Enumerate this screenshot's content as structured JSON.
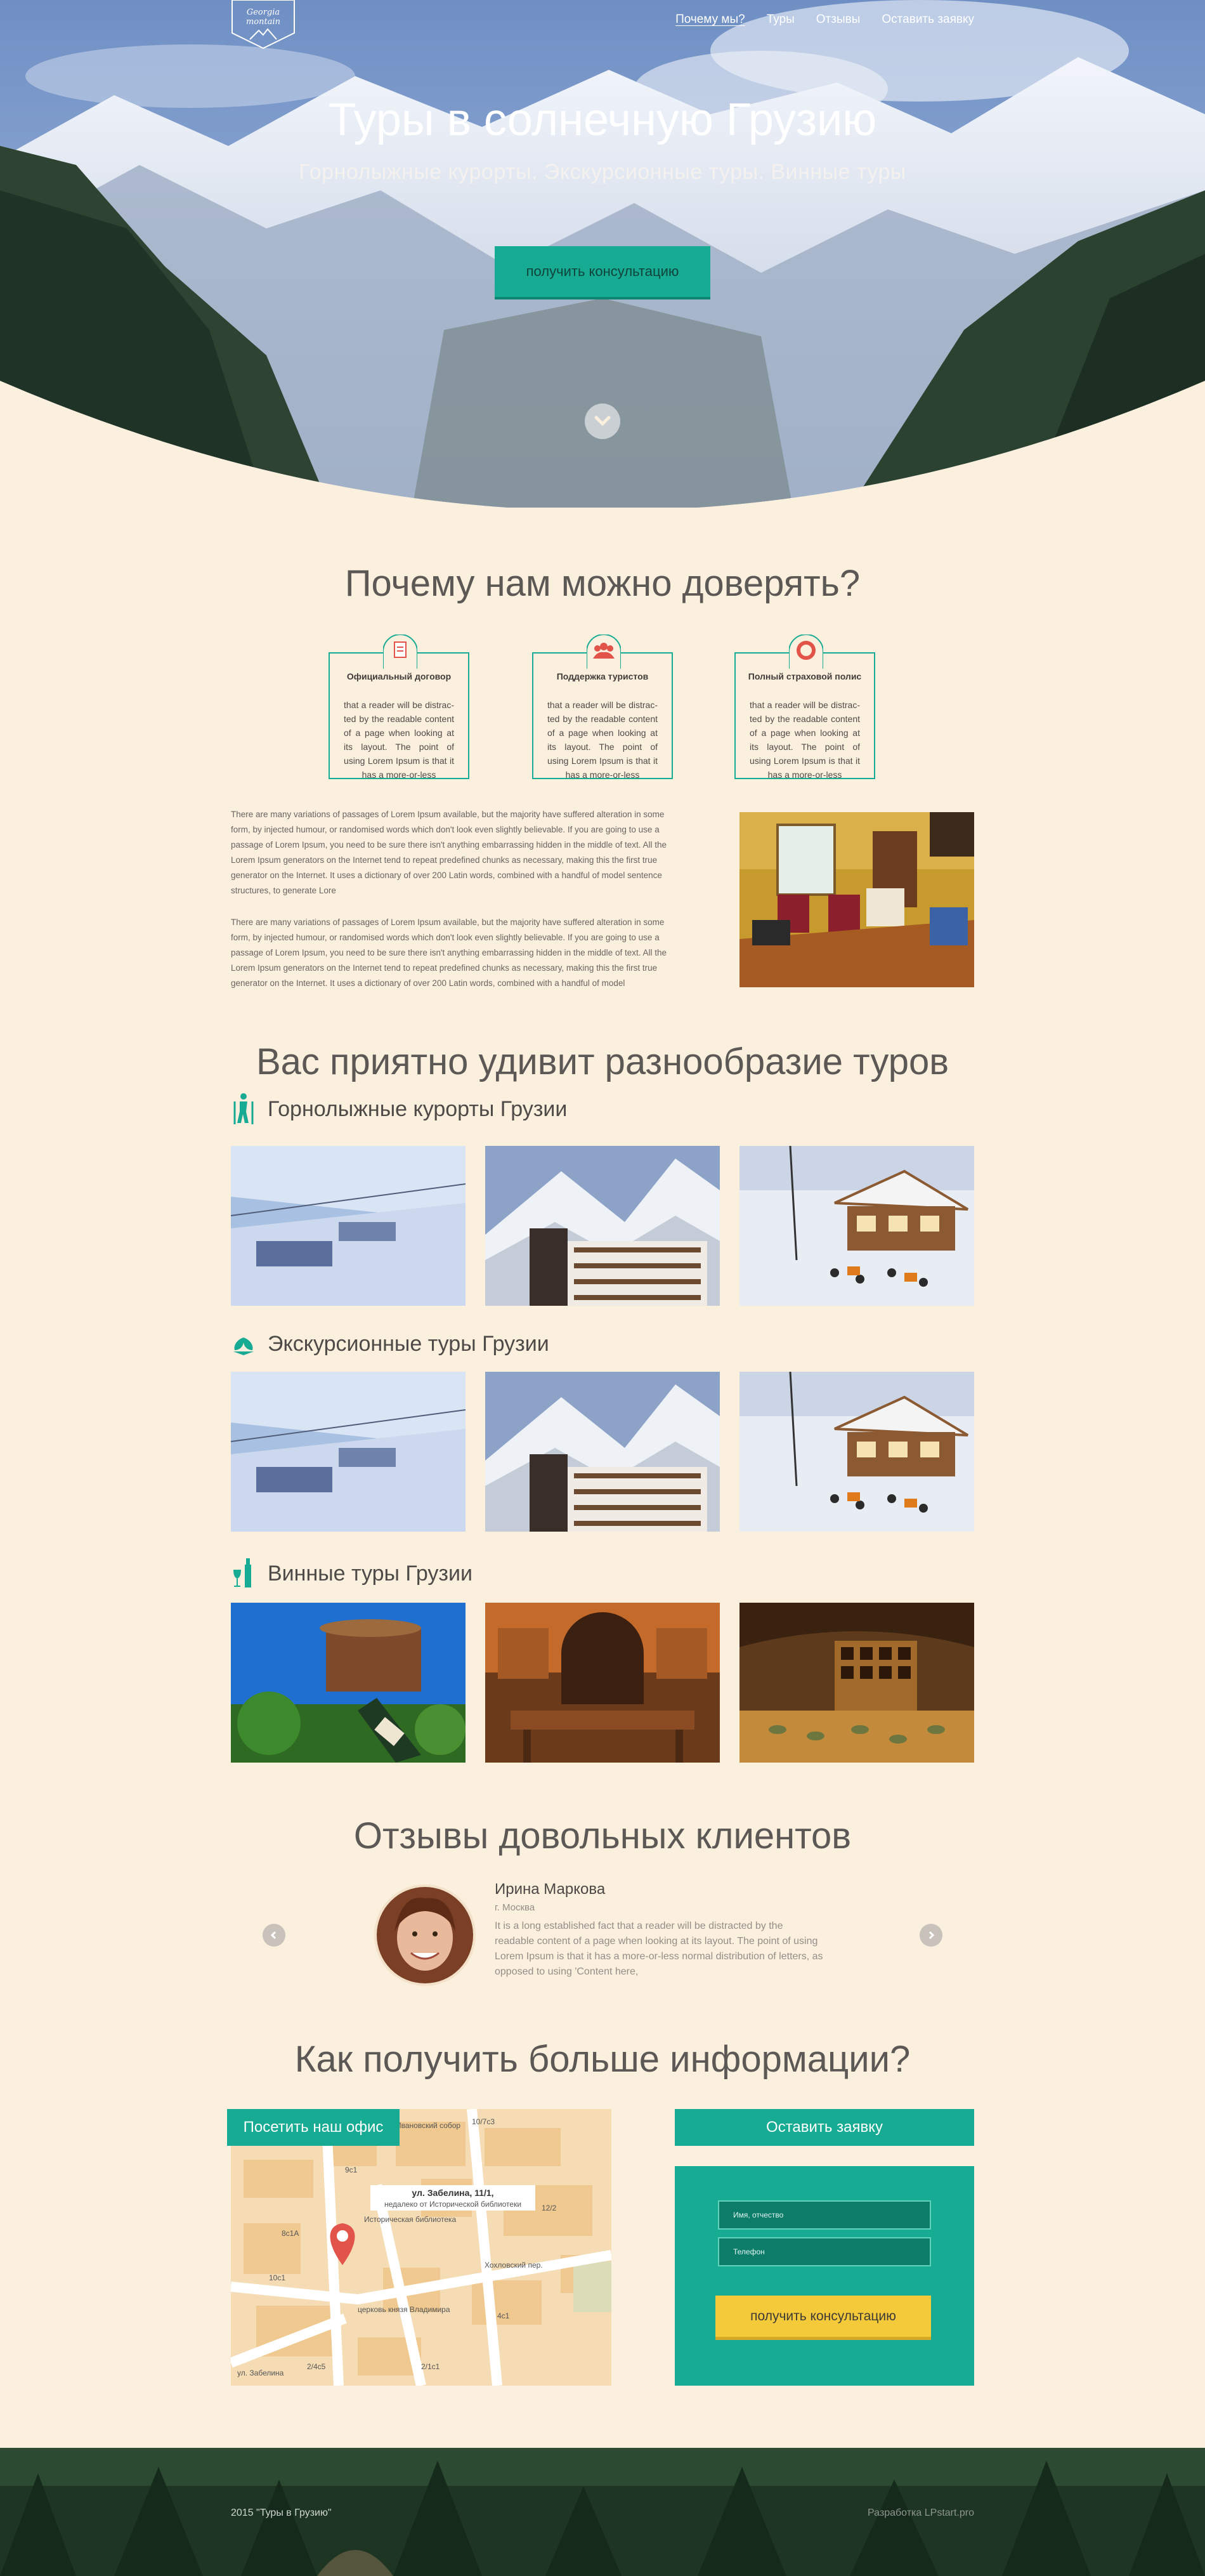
{
  "logo": {
    "line1": "Georgia",
    "line2": "montain"
  },
  "nav": [
    {
      "label": "Почему мы?"
    },
    {
      "label": "Туры"
    },
    {
      "label": "Отзывы"
    },
    {
      "label": "Оставить заявку"
    }
  ],
  "hero": {
    "title": "Туры в солнечную Грузию",
    "subtitle": "Горнолыжные курорты. Экскурсионные туры. Винные туры",
    "button": "получить консультацию"
  },
  "trust": {
    "title": "Почему нам можно доверять?",
    "cards": [
      {
        "title": "Официальный договор",
        "text": "that a reader will be distrac-ted by the readable content of a page when looking at its layout. The point of using Lorem Ipsum is that it has a more-or-less",
        "icon": "document-icon"
      },
      {
        "title": "Поддержка туристов",
        "text": "that a reader will be distrac-ted by the readable content of a page when looking at its layout. The point of using Lorem Ipsum is that it has a more-or-less",
        "icon": "group-icon"
      },
      {
        "title": "Полный страховой полис",
        "text": "that a reader will be distrac-ted by the readable content of a page when looking at its layout. The point of using Lorem Ipsum is that it has a more-or-less",
        "icon": "lifebuoy-icon"
      }
    ],
    "paragraph1": "There are many variations of passages of Lorem Ipsum available, but the majority have suffered alteration in some form, by injected humour, or randomised words which don't look even slightly believable. If you are going to use a passage of Lorem Ipsum, you need to be sure there isn't anything embarrassing hidden in the middle of text. All the Lorem Ipsum generators on the Internet tend to repeat predefined chunks as necessary, making this the first true generator on the Internet. It uses a dictionary of over 200 Latin words, combined with a handful of model sentence structures, to generate Lore",
    "paragraph2": "There are many variations of passages of Lorem Ipsum available, but the majority have suffered alteration in some form, by injected humour, or randomised words which don't look even slightly believable. If you are going to use a passage of Lorem Ipsum, you need to be sure there isn't anything embarrassing hidden in the middle of text. All the Lorem Ipsum generators on the Internet tend to repeat predefined chunks as necessary, making this the first true generator on the Internet. It uses a dictionary of over 200 Latin words, combined with a handful of model"
  },
  "tours": {
    "title": "Вас приятно удивит разнообразие туров",
    "categories": [
      {
        "name": "Горнолыжные курорты Грузии",
        "icon": "skier-icon"
      },
      {
        "name": "Экскурсионные туры Грузии",
        "icon": "leaf-icon"
      },
      {
        "name": "Винные туры Грузии",
        "icon": "wine-icon"
      }
    ]
  },
  "reviews": {
    "title": "Отзывы довольных клиентов",
    "name": "Ирина Маркова",
    "city": "г. Москва",
    "text": "It is a long established fact that a reader will be distracted by the readable content of a page when looking at its layout. The point of using Lorem Ipsum is that it has a more-or-less normal distribution of letters, as opposed to using 'Content here,"
  },
  "contact": {
    "title": "Как получить больше информации?",
    "office_tab": "Посетить наш офис",
    "form_tab": "Оставить заявку",
    "map_address": "ул. Забелина, 11/1,",
    "map_note": "недалеко от Исторической библиотеки",
    "map_labels": [
      "Ивановский собор",
      "10/7с3",
      "9с1",
      "Историческая библиотека",
      "церковь князя Владимира",
      "Хохловский пер.",
      "ул. Забелина",
      "8с1А",
      "10с1",
      "2/4с5",
      "12/2",
      "4с1",
      "2/1с1"
    ],
    "name_placeholder": "Имя, отчество",
    "phone_placeholder": "Телефон",
    "submit": "получить консультацию"
  },
  "footer": {
    "left": "2015 \"Туры в Грузию\"",
    "right": "Разработка LPstart.pro"
  },
  "colors": {
    "accent": "#17ab93",
    "background": "#fbefdd",
    "button_yellow": "#f4c93a"
  }
}
